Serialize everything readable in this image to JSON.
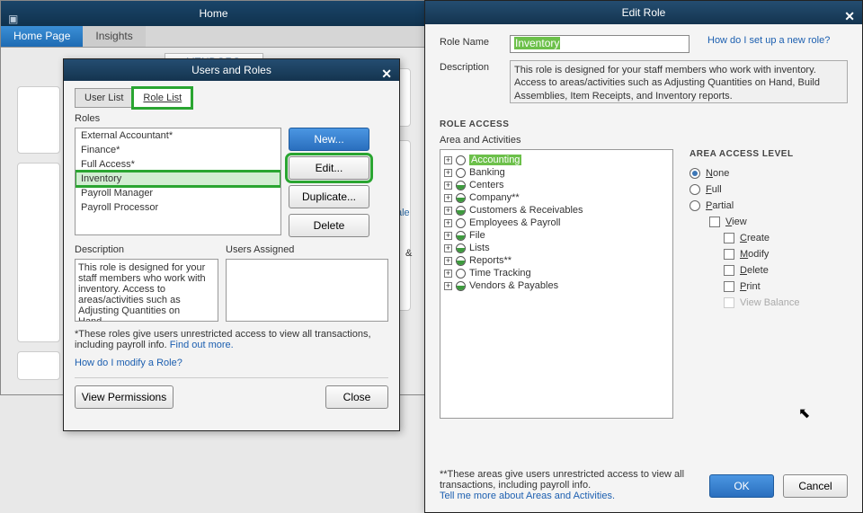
{
  "main": {
    "title": "Home",
    "tabs": {
      "home": "Home Page",
      "insights": "Insights"
    },
    "vendors": "VENDORS",
    "side_le": "ale",
    "side_amp": "&"
  },
  "ur": {
    "title": "Users and Roles",
    "tabs": {
      "user_list": "User List",
      "role_list": "Role List"
    },
    "roles_label": "Roles",
    "roles": [
      "External Accountant*",
      "Finance*",
      "Full Access*",
      "Inventory",
      "Payroll Manager",
      "Payroll Processor"
    ],
    "buttons": {
      "new": "New...",
      "edit": "Edit...",
      "duplicate": "Duplicate...",
      "delete": "Delete"
    },
    "desc_label": "Description",
    "users_label": "Users Assigned",
    "desc_text": "This role is designed for your staff members who work with inventory. Access to areas/activities such as Adjusting Quantities on Hand,...",
    "note_pre": "*These roles give users unrestricted access to view all transactions, including payroll info.  ",
    "find_more": "Find out more.",
    "modify_link": "How do I modify a Role?",
    "view_perms": "View Permissions",
    "close": "Close"
  },
  "er": {
    "title": "Edit Role",
    "role_name_label": "Role Name",
    "role_name_value": "Inventory",
    "help_link": "How do I set up a new role?",
    "desc_label": "Description",
    "desc_value": "This role is designed for your staff members who work with inventory. Access to areas/activities such as Adjusting Quantities on Hand, Build Assemblies, Item Receipts, and Inventory reports.",
    "role_access": "ROLE ACCESS",
    "area_activities": "Area and Activities",
    "tree": [
      {
        "label": "Accounting",
        "fill": "none",
        "sel": true
      },
      {
        "label": "Banking",
        "fill": "none"
      },
      {
        "label": "Centers",
        "fill": "half"
      },
      {
        "label": "Company**",
        "fill": "half"
      },
      {
        "label": "Customers & Receivables",
        "fill": "half"
      },
      {
        "label": "Employees & Payroll",
        "fill": "none"
      },
      {
        "label": "File",
        "fill": "half"
      },
      {
        "label": "Lists",
        "fill": "half"
      },
      {
        "label": "Reports**",
        "fill": "half"
      },
      {
        "label": "Time Tracking",
        "fill": "none"
      },
      {
        "label": "Vendors & Payables",
        "fill": "half"
      }
    ],
    "access_level": "AREA ACCESS LEVEL",
    "levels": {
      "none": "None",
      "full": "Full",
      "partial": "Partial"
    },
    "perms": {
      "view": "View",
      "create": "Create",
      "modify": "Modify",
      "delete": "Delete",
      "print": "Print",
      "view_balance": "View Balance"
    },
    "note": "**These areas give users unrestricted access to view all transactions, including payroll info.",
    "tell_more": "Tell me more about Areas and Activities.",
    "ok": "OK",
    "cancel": "Cancel"
  }
}
